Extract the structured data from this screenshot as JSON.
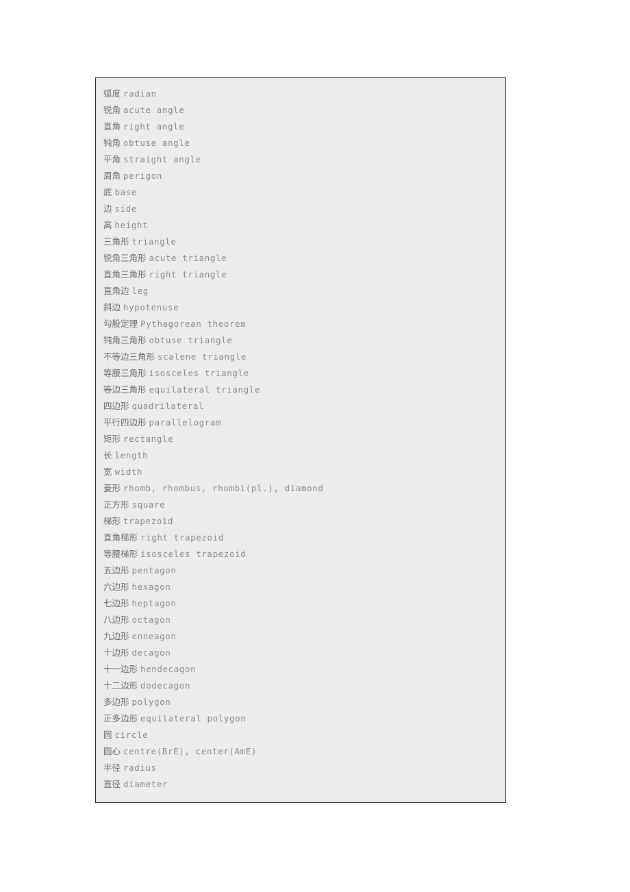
{
  "document": {
    "type": "glossary",
    "topic": "Geometry terms Chinese-English glossary",
    "entries": [
      {
        "cn": "弧度",
        "en": "radian"
      },
      {
        "cn": "锐角",
        "en": "acute angle"
      },
      {
        "cn": "直角",
        "en": "right angle"
      },
      {
        "cn": "钝角",
        "en": "obtuse angle"
      },
      {
        "cn": "平角",
        "en": "straight angle"
      },
      {
        "cn": "周角",
        "en": "perigon"
      },
      {
        "cn": "底",
        "en": "base"
      },
      {
        "cn": "边",
        "en": "side"
      },
      {
        "cn": "高",
        "en": "height"
      },
      {
        "cn": "三角形",
        "en": "triangle"
      },
      {
        "cn": "锐角三角形",
        "en": "acute triangle"
      },
      {
        "cn": "直角三角形",
        "en": "right triangle"
      },
      {
        "cn": "直角边",
        "en": "leg"
      },
      {
        "cn": "斜边",
        "en": "hypotenuse"
      },
      {
        "cn": "勾股定理",
        "en": "Pythagorean theorem"
      },
      {
        "cn": "钝角三角形",
        "en": "obtuse triangle"
      },
      {
        "cn": "不等边三角形",
        "en": "scalene triangle"
      },
      {
        "cn": "等腰三角形",
        "en": "isosceles triangle"
      },
      {
        "cn": "等边三角形",
        "en": "equilateral triangle"
      },
      {
        "cn": "四边形",
        "en": "quadrilateral"
      },
      {
        "cn": "平行四边形",
        "en": "parallelogram"
      },
      {
        "cn": "矩形",
        "en": "rectangle"
      },
      {
        "cn": "长",
        "en": "length"
      },
      {
        "cn": "宽",
        "en": "width"
      },
      {
        "cn": "菱形",
        "en": "rhomb, rhombus, rhombi(pl.), diamond"
      },
      {
        "cn": "正方形",
        "en": "square"
      },
      {
        "cn": "梯形",
        "en": "trapezoid"
      },
      {
        "cn": "直角梯形",
        "en": "right trapezoid"
      },
      {
        "cn": "等腰梯形",
        "en": "isosceles trapezoid"
      },
      {
        "cn": "五边形",
        "en": "pentagon"
      },
      {
        "cn": "六边形",
        "en": "hexagon"
      },
      {
        "cn": "七边形",
        "en": "heptagon"
      },
      {
        "cn": "八边形",
        "en": "octagon"
      },
      {
        "cn": "九边形",
        "en": "enneagon"
      },
      {
        "cn": "十边形",
        "en": "decagon"
      },
      {
        "cn": "十一边形",
        "en": "hendecagon"
      },
      {
        "cn": "十二边形",
        "en": "dodecagon"
      },
      {
        "cn": "多边形",
        "en": "polygon"
      },
      {
        "cn": "正多边形",
        "en": "equilateral polygon"
      },
      {
        "cn": "圆",
        "en": "circle"
      },
      {
        "cn": "圆心",
        "en": "centre(BrE), center(AmE)"
      },
      {
        "cn": "半径",
        "en": "radius"
      },
      {
        "cn": "直径",
        "en": "diameter"
      }
    ]
  },
  "colors": {
    "page_background": "#ffffff",
    "box_background": "#ececec",
    "box_border": "#2b2b2b",
    "text_cn": "#6e6e6e",
    "text_en": "#8c8c8c"
  }
}
